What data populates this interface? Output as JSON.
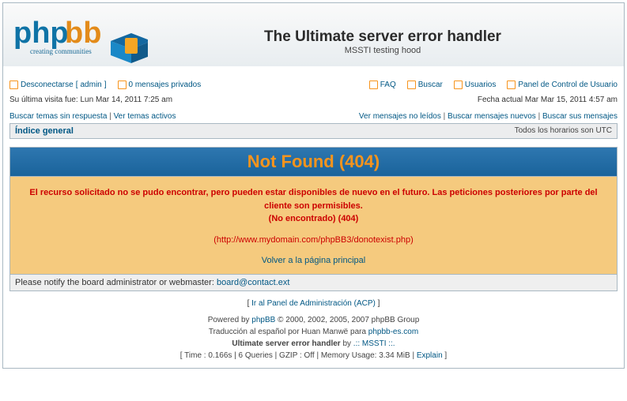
{
  "header": {
    "title": "The Ultimate server error handler",
    "subtitle": "MSSTI testing hood",
    "logo_text1": "php",
    "logo_text2": "bb",
    "logo_tag": "creating communities"
  },
  "nav": {
    "logout": "Desconectarse",
    "admin": "admin",
    "pm": "0 mensajes privados",
    "faq": "FAQ",
    "search": "Buscar",
    "users": "Usuarios",
    "ucp": "Panel de Control de Usuario"
  },
  "visit": {
    "last": "Su última visita fue: Lun Mar 14, 2011 7:25 am",
    "now": "Fecha actual Mar Mar 15, 2011 4:57 am"
  },
  "searchlinks": {
    "unanswered": "Buscar temas sin respuesta",
    "active": "Ver temas activos",
    "unread": "Ver mensajes no leídos",
    "newposts": "Buscar mensajes nuevos",
    "yourposts": "Buscar sus mensajes"
  },
  "index": {
    "label": "Índice general",
    "tz": "Todos los horarios son UTC"
  },
  "error": {
    "title": "Not Found (404)",
    "msg1": "El recurso solicitado no se pudo encontrar, pero pueden estar disponibles de nuevo en el futuro. Las peticiones posteriores por parte del cliente son permisibles.",
    "msg2": "(No encontrado) (404)",
    "url": "(http://www.mydomain.com/phpBB3/donotexist.php)",
    "back": "Volver a la página principal"
  },
  "notify": {
    "text": "Please notify the board administrator or webmaster: ",
    "email": "board@contact.ext"
  },
  "acp": {
    "open": "[ ",
    "link": "Ir al Panel de Administración (ACP)",
    "close": " ]"
  },
  "footer": {
    "powered1": "Powered by ",
    "phpbb": "phpBB",
    "powered2": " © 2000, 2002, 2005, 2007 phpBB Group",
    "trans1": "Traducción al español por Huan Manwë para ",
    "trans2": "phpbb-es.com",
    "mod1": "Ultimate server error handler",
    "mod2": " by ",
    "mod3": ".:: MSSTI ::.",
    "stats": "[ Time : 0.166s | 6 Queries | GZIP : Off | Memory Usage: 3.34 MiB | ",
    "explain": "Explain",
    "close": " ]"
  }
}
